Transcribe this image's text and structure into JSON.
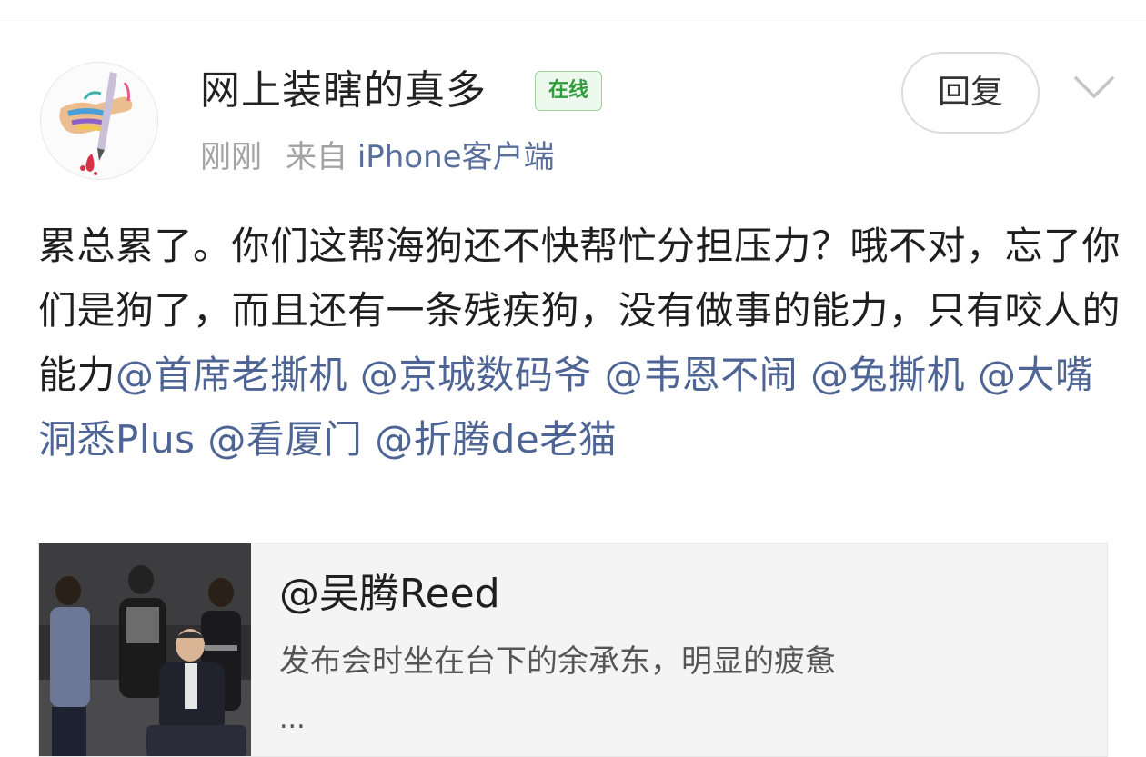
{
  "post": {
    "author": {
      "name": "网上装瞎的真多",
      "status_badge": "在线",
      "time": "刚刚",
      "source_prefix": "来自",
      "source_client": "iPhone客户端"
    },
    "actions": {
      "reply_label": "回复",
      "more_icon": "chevron-down-icon"
    },
    "content": {
      "text": "累总累了。你们这帮海狗还不快帮忙分担压力？哦不对，忘了你们是狗了，而且还有一条残疾狗，没有做事的能力，只有咬人的能力",
      "mentions": [
        "@首席老撕机",
        "@京城数码爷",
        "@韦恩不闹",
        "@兔撕机",
        "@大嘴洞悉Plus",
        "@看厦门",
        "@折腾de老猫"
      ]
    },
    "repost": {
      "author": "@吴腾Reed",
      "snippet": "发布会时坐在台下的余承东，明显的疲惫",
      "ellipsis": "..."
    }
  },
  "colors": {
    "mention": "#4e6494",
    "online_badge_text": "#2e9c3a",
    "online_badge_bg": "#eef9ee",
    "meta_gray": "#a3a3a3"
  }
}
